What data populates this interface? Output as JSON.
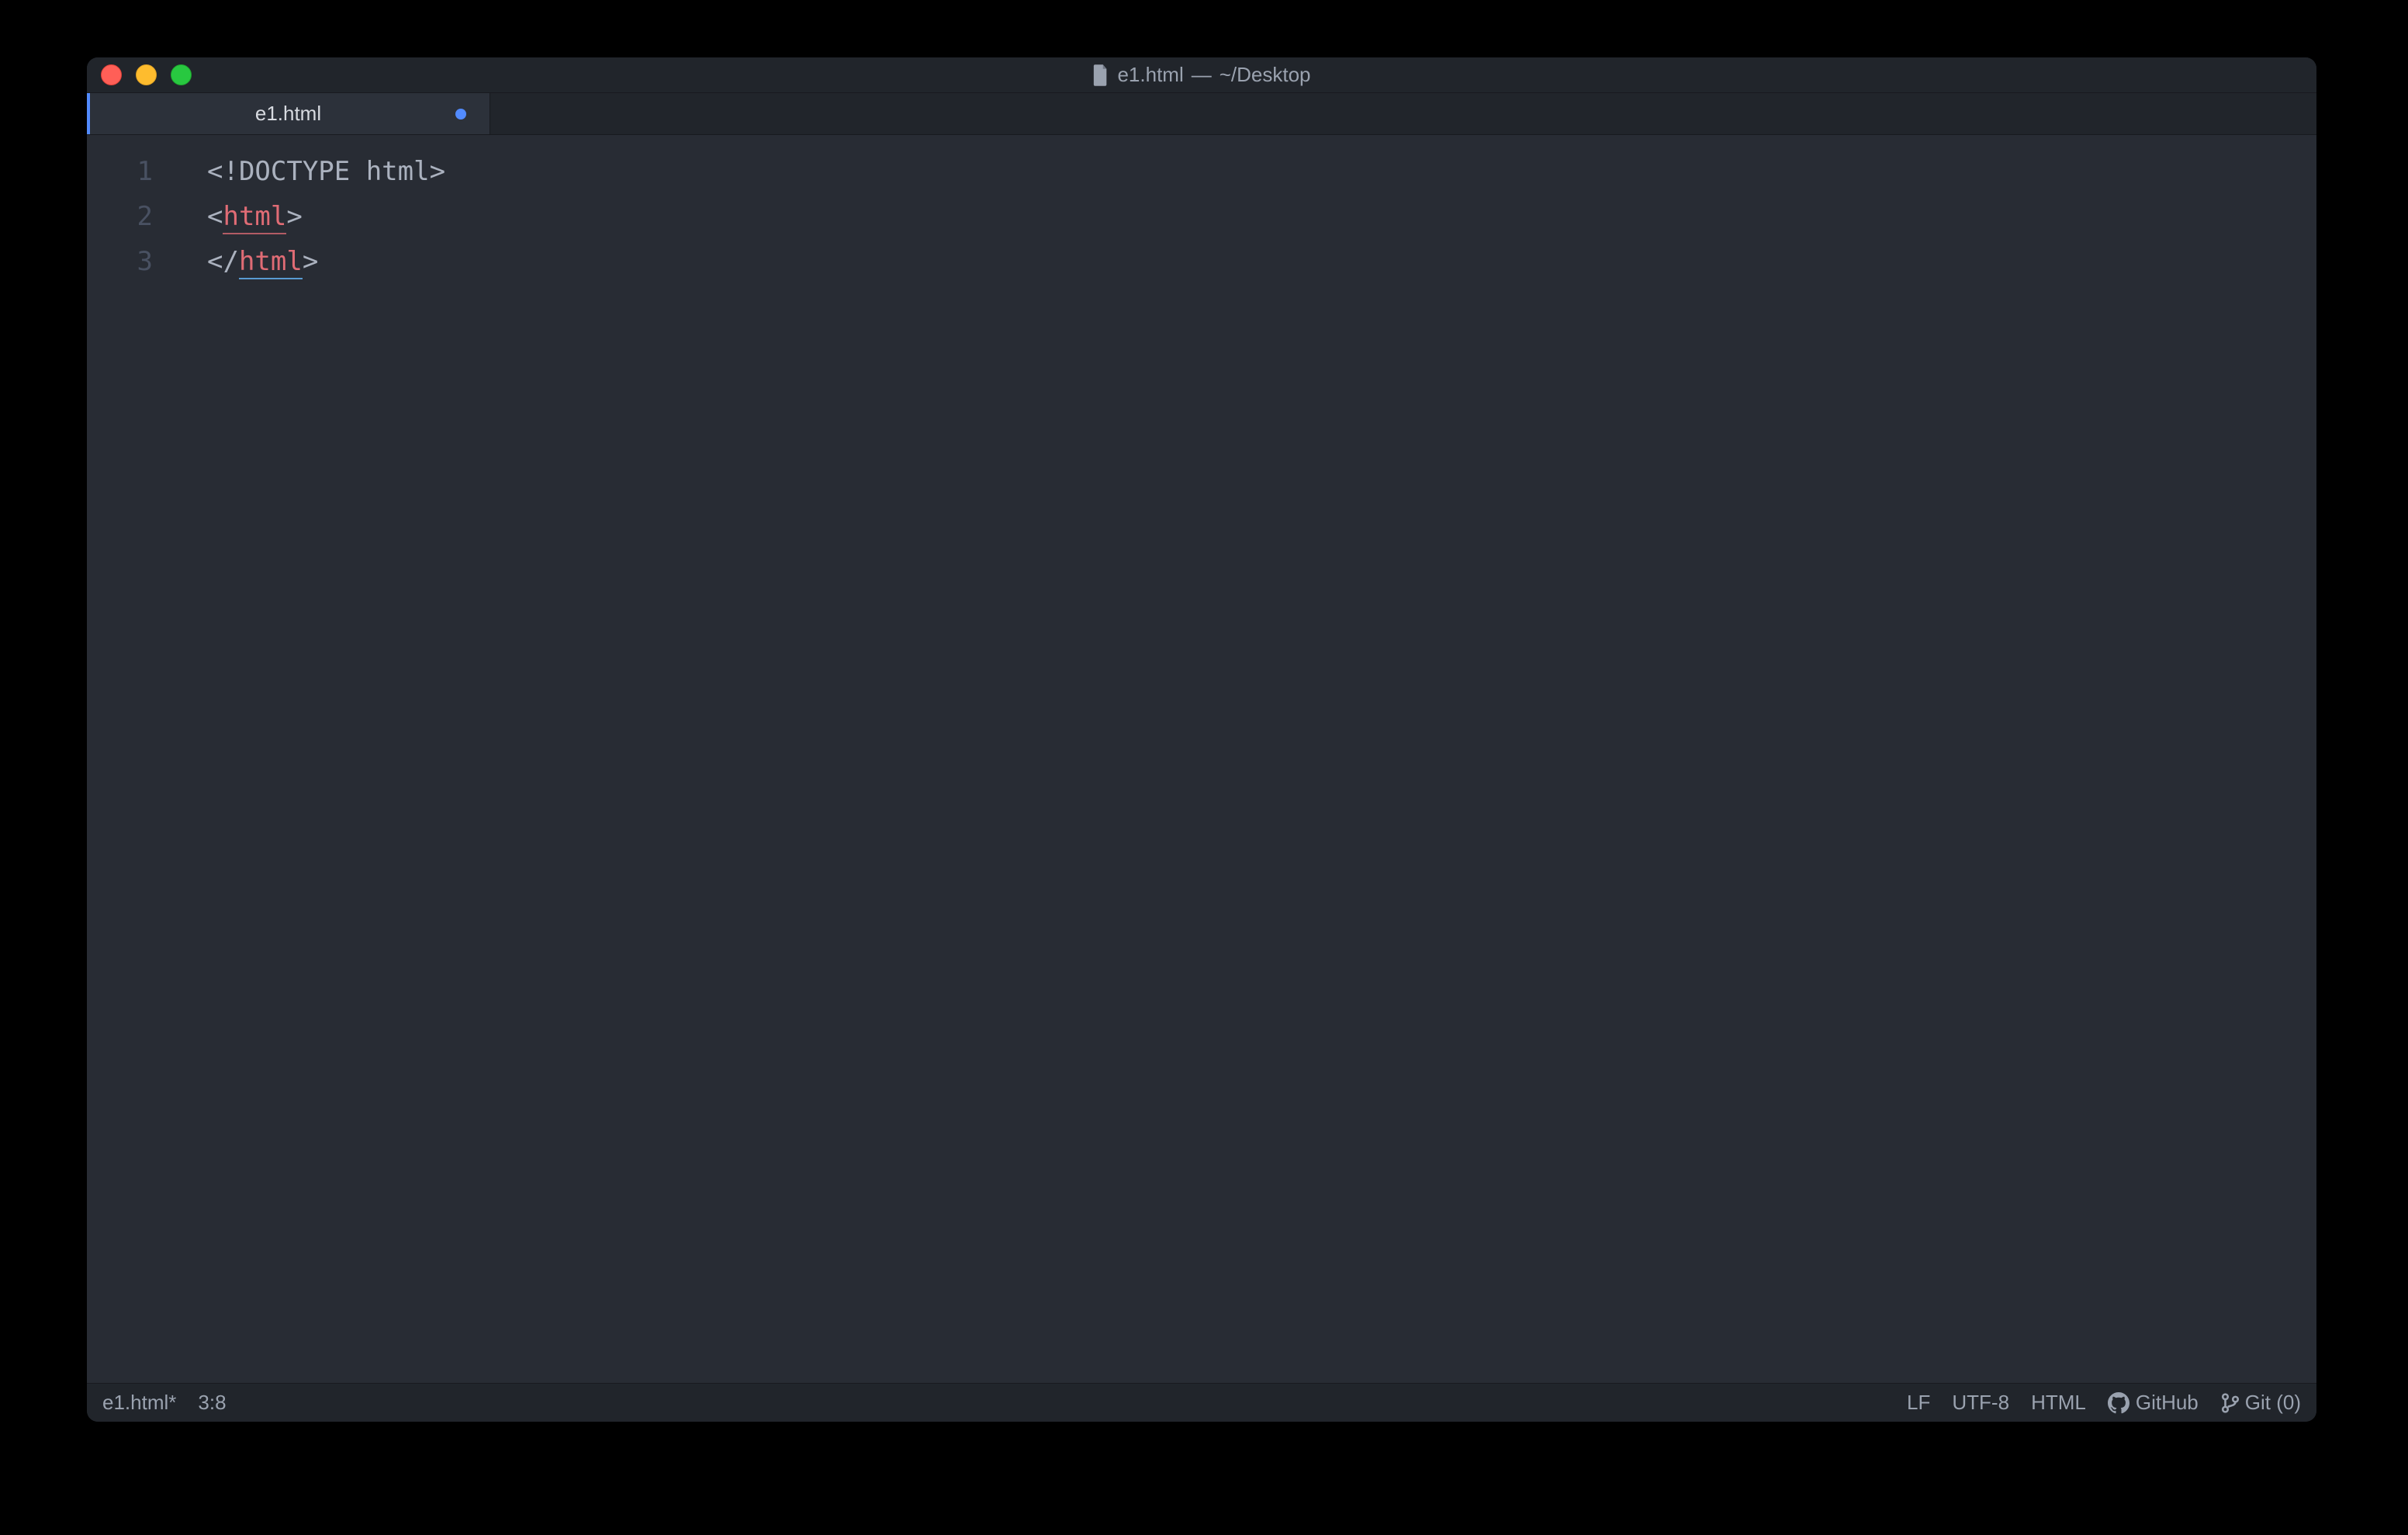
{
  "window": {
    "title_filename": "e1.html",
    "title_separator": " — ",
    "title_path": "~/Desktop"
  },
  "tabs": [
    {
      "label": "e1.html",
      "dirty": true,
      "active": true
    }
  ],
  "editor": {
    "lines": [
      {
        "num": "1",
        "tokens": [
          {
            "t": "<!DOCTYPE html>",
            "cls": "doctype"
          }
        ]
      },
      {
        "num": "2",
        "tokens": [
          {
            "t": "<",
            "cls": "punct"
          },
          {
            "t": "html",
            "cls": "tagname underline-open"
          },
          {
            "t": ">",
            "cls": "punct"
          }
        ]
      },
      {
        "num": "3",
        "current": true,
        "tokens": [
          {
            "t": "</",
            "cls": "punct"
          },
          {
            "t": "html",
            "cls": "tagname underline-close"
          },
          {
            "t": ">",
            "cls": "punct"
          }
        ]
      }
    ]
  },
  "status": {
    "filename": "e1.html*",
    "cursor": "3:8",
    "eol": "LF",
    "encoding": "UTF-8",
    "grammar": "HTML",
    "github": "GitHub",
    "git": "Git (0)"
  }
}
